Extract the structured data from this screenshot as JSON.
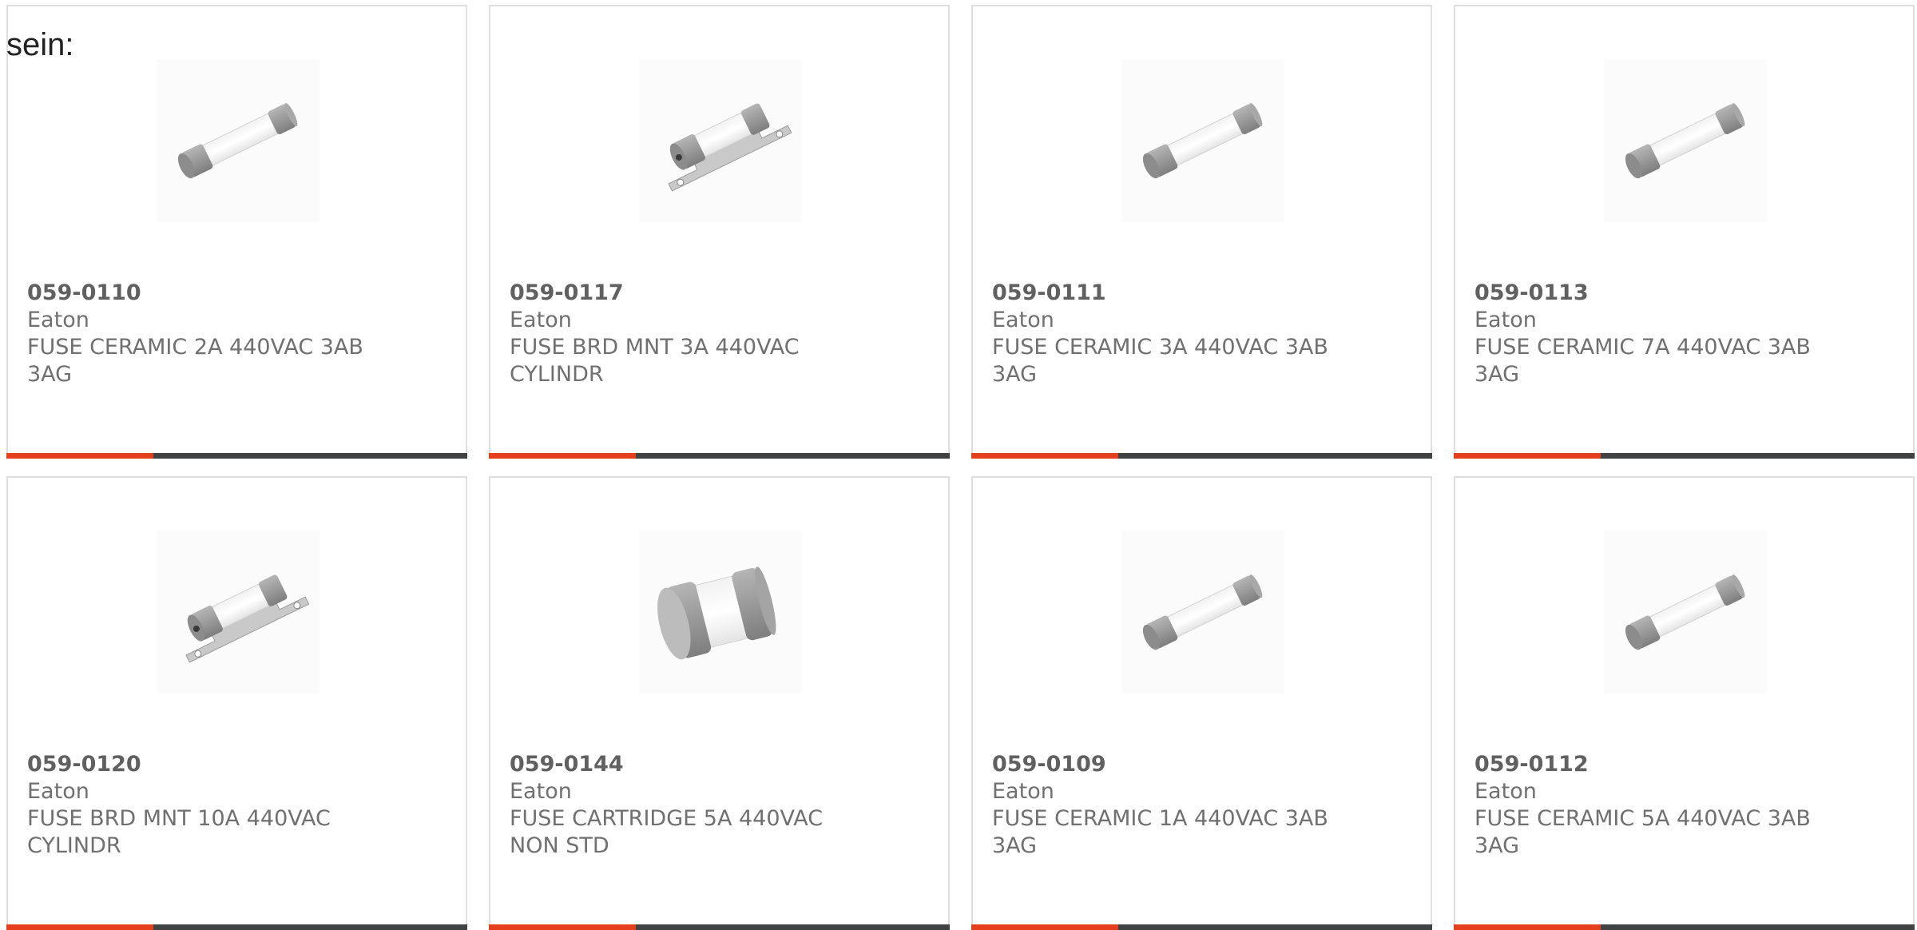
{
  "intro_text": "sein:",
  "colors": {
    "accent": "#e5401d",
    "bar": "#404244",
    "border": "#dedede",
    "text": "#707070"
  },
  "products": [
    {
      "part": "059-0110",
      "maker": "Eaton",
      "description": "FUSE CERAMIC 2A 440VAC 3AB 3AG",
      "image": "ceramic-fuse-icon"
    },
    {
      "part": "059-0117",
      "maker": "Eaton",
      "description": "FUSE BRD MNT 3A 440VAC CYLINDR",
      "image": "board-mount-fuse-icon"
    },
    {
      "part": "059-0111",
      "maker": "Eaton",
      "description": "FUSE CERAMIC 3A 440VAC 3AB 3AG",
      "image": "ceramic-fuse-icon"
    },
    {
      "part": "059-0113",
      "maker": "Eaton",
      "description": "FUSE CERAMIC 7A 440VAC 3AB 3AG",
      "image": "ceramic-fuse-icon"
    },
    {
      "part": "059-0120",
      "maker": "Eaton",
      "description": "FUSE BRD MNT 10A 440VAC CYLINDR",
      "image": "board-mount-fuse-icon"
    },
    {
      "part": "059-0144",
      "maker": "Eaton",
      "description": "FUSE CARTRIDGE 5A 440VAC NON STD",
      "image": "cartridge-fuse-icon"
    },
    {
      "part": "059-0109",
      "maker": "Eaton",
      "description": "FUSE CERAMIC 1A 440VAC 3AB 3AG",
      "image": "ceramic-fuse-icon"
    },
    {
      "part": "059-0112",
      "maker": "Eaton",
      "description": "FUSE CERAMIC 5A 440VAC 3AB 3AG",
      "image": "ceramic-fuse-icon"
    }
  ]
}
